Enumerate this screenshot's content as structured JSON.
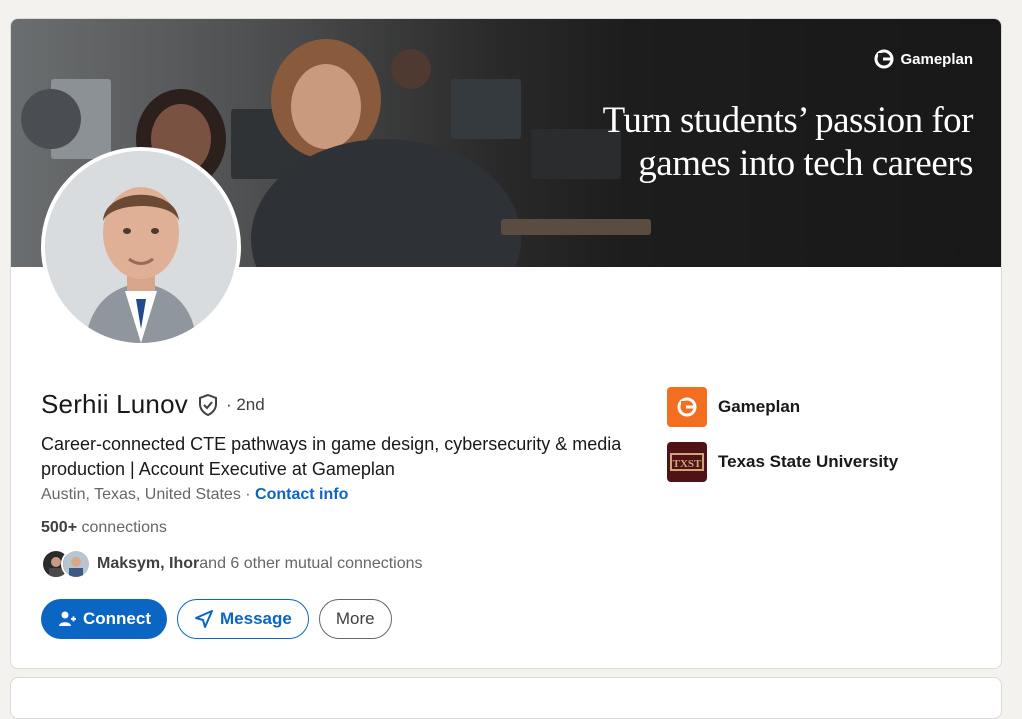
{
  "banner": {
    "brand_name": "Gameplan",
    "tagline_line1": "Turn students’ passion for",
    "tagline_line2": "games into tech careers"
  },
  "profile": {
    "name": "Serhii Lunov",
    "degree": "· 2nd",
    "headline": "Career-connected CTE pathways in game design, cybersecurity & media production | Account Executive at Gameplan",
    "location": "Austin, Texas, United States",
    "separator": " · ",
    "contact_info_label": "Contact info",
    "connections_count": "500+",
    "connections_label": " connections",
    "mutual_names": "Maksym, Ihor",
    "mutual_rest": " and 6 other mutual connections"
  },
  "actions": {
    "connect_label": "Connect",
    "message_label": "Message",
    "more_label": "More"
  },
  "organizations": [
    {
      "name": "Gameplan",
      "logo_icon": "gameplan-logo",
      "logo_color": "#f26f21"
    },
    {
      "name": "Texas State University",
      "logo_icon": "txst-logo",
      "logo_color": "#501214",
      "logo_text": "TXST"
    }
  ],
  "colors": {
    "accent": "#0a66c2",
    "page_bg": "#f4f2ee"
  }
}
